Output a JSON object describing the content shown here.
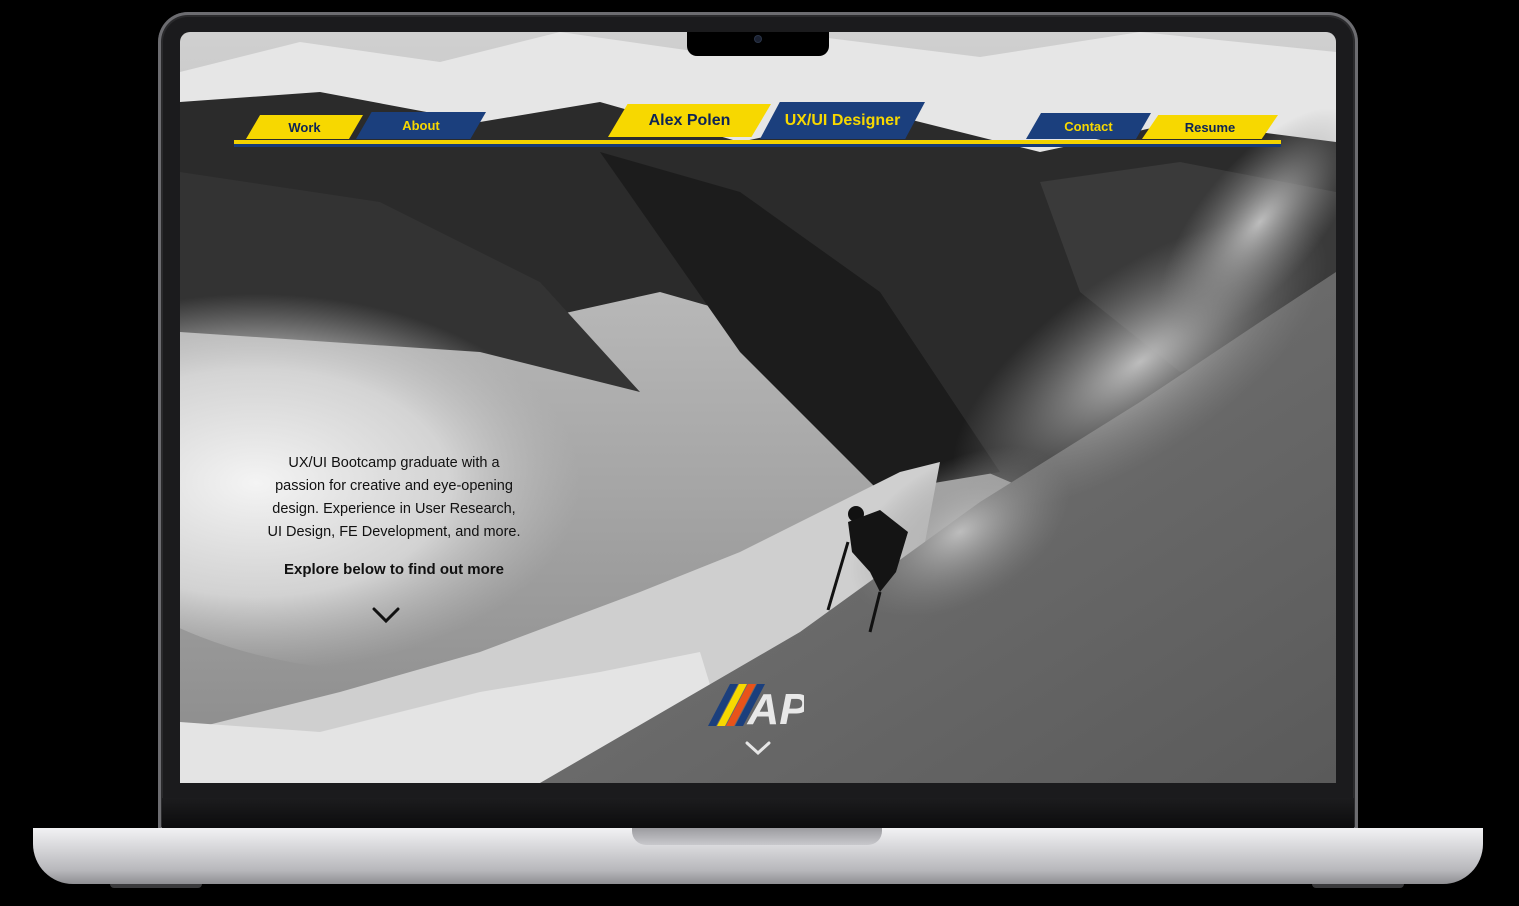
{
  "nav": {
    "left_items": [
      "Work",
      "About"
    ],
    "brand_name": "Alex Polen",
    "brand_role": "UX/UI Designer",
    "right_items": [
      "Contact",
      "Resume"
    ]
  },
  "hero": {
    "description_lines": [
      "UX/UI Bootcamp graduate with a",
      "passion for creative and eye-opening",
      "design. Experience in User Research,",
      "UI Design, FE Development, and more."
    ],
    "cta": "Explore below to find out more",
    "cta_icon": "chevron-down-icon"
  },
  "logo": {
    "text": "AP",
    "stripe_colors": [
      "#1b3f7d",
      "#f7d800",
      "#e8531a"
    ],
    "scroll_icon": "chevron-down-icon"
  },
  "colors": {
    "accent_yellow": "#f7d800",
    "accent_blue": "#1b3f7d",
    "accent_orange": "#e8531a"
  }
}
